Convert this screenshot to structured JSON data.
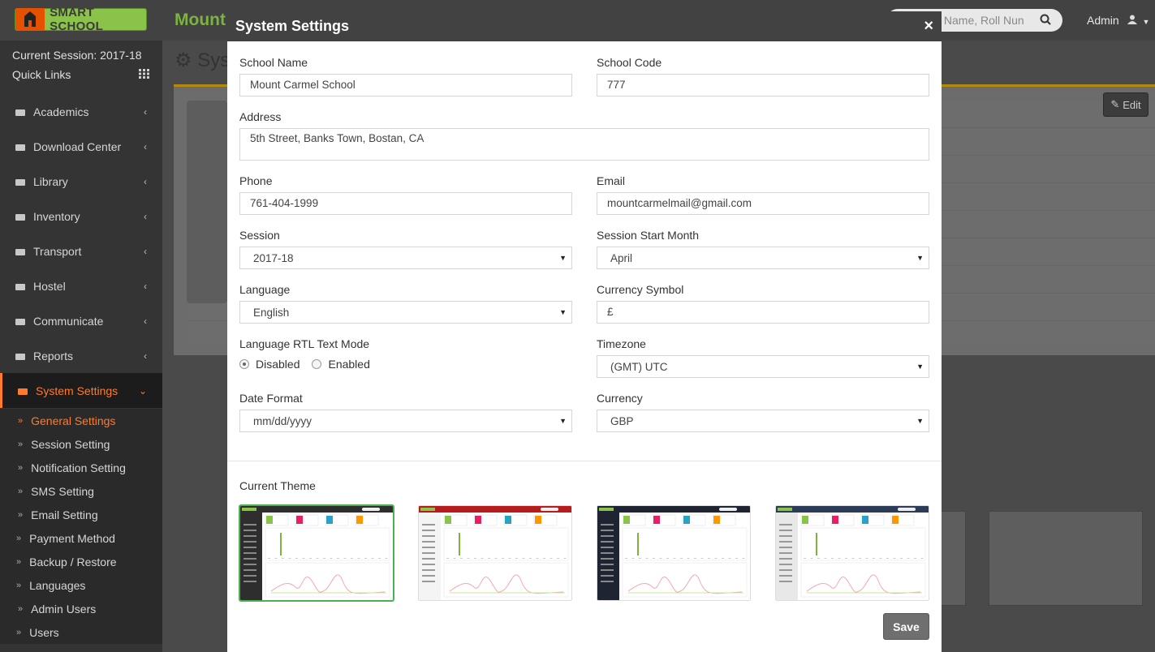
{
  "app": {
    "logo_text": "SMART SCHOOL",
    "brand": "Mount",
    "search_placeholder": "y Name, Roll Nun",
    "admin_label": "Admin"
  },
  "sidebar": {
    "current_session": "Current Session: 2017-18",
    "quick_links": "Quick Links",
    "items": [
      {
        "label": "Academics",
        "icon": "graduation-cap-icon"
      },
      {
        "label": "Download Center",
        "icon": "download-icon"
      },
      {
        "label": "Library",
        "icon": "book-icon"
      },
      {
        "label": "Inventory",
        "icon": "inventory-icon"
      },
      {
        "label": "Transport",
        "icon": "bus-icon"
      },
      {
        "label": "Hostel",
        "icon": "building-icon"
      },
      {
        "label": "Communicate",
        "icon": "bullhorn-icon"
      },
      {
        "label": "Reports",
        "icon": "line-chart-icon"
      },
      {
        "label": "System Settings",
        "icon": "gears-icon"
      }
    ],
    "subitems": [
      "General Settings",
      "Session Setting",
      "Notification Setting",
      "SMS Setting",
      "Email Setting",
      "Payment Method",
      "Backup / Restore",
      "Languages",
      "Admin Users",
      "Users"
    ],
    "active_subitem": "General Settings"
  },
  "background": {
    "page_title": "Sys",
    "edit_label": "Edit"
  },
  "modal": {
    "title": "System Settings",
    "close_label": "×",
    "fields": {
      "school_name": {
        "label": "School Name",
        "value": "Mount Carmel School"
      },
      "school_code": {
        "label": "School Code",
        "value": "777"
      },
      "address": {
        "label": "Address",
        "value": "5th Street, Banks Town, Bostan, CA"
      },
      "phone": {
        "label": "Phone",
        "value": "761-404-1999"
      },
      "email": {
        "label": "Email",
        "value": "mountcarmelmail@gmail.com"
      },
      "session": {
        "label": "Session",
        "value": "2017-18"
      },
      "session_start_month": {
        "label": "Session Start Month",
        "value": "April"
      },
      "language": {
        "label": "Language",
        "value": "English"
      },
      "currency_symbol": {
        "label": "Currency Symbol",
        "value": "£"
      },
      "rtl": {
        "label": "Language RTL Text Mode",
        "options": [
          "Disabled",
          "Enabled"
        ],
        "selected": "Disabled"
      },
      "timezone": {
        "label": "Timezone",
        "value": "(GMT) UTC"
      },
      "date_format": {
        "label": "Date Format",
        "value": "mm/dd/yyyy"
      },
      "currency": {
        "label": "Currency",
        "value": "GBP"
      }
    },
    "theme_label": "Current Theme",
    "themes": [
      {
        "name": "green",
        "header_color": "#2e2e2e",
        "accent": "#8bc34a",
        "sidebar_color": "#2e2e2e",
        "selected": true
      },
      {
        "name": "red",
        "header_color": "#b71c1c",
        "accent": "#8bc34a",
        "sidebar_color": "#f4f4f4",
        "selected": false
      },
      {
        "name": "dark",
        "header_color": "#1f2433",
        "accent": "#8bc34a",
        "sidebar_color": "#1f2433",
        "selected": false
      },
      {
        "name": "blue",
        "header_color": "#2c3b57",
        "accent": "#8bc34a",
        "sidebar_color": "#e8e8e8",
        "selected": false
      }
    ],
    "save_label": "Save"
  }
}
